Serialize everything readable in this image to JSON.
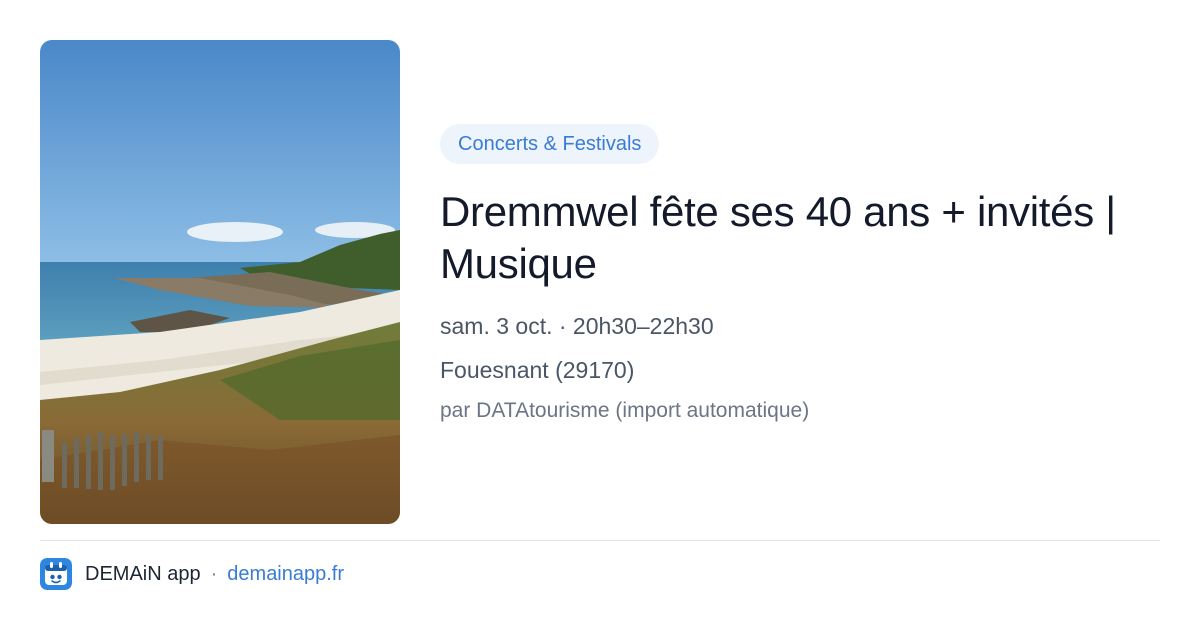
{
  "event": {
    "category": "Concerts & Festivals",
    "title": "Dremmwel fête ses 40 ans + invités | Musique",
    "date": "sam. 3 oct. · 20h30–22h30",
    "location": "Fouesnant (29170)",
    "source": "par DATAtourisme (import automatique)"
  },
  "footer": {
    "app_name": "DEMAiN app",
    "separator": "·",
    "url": "demainapp.fr"
  },
  "colors": {
    "accent": "#3a7bd5",
    "badge_bg": "#eef4fb",
    "title": "#141a2a",
    "meta": "#4a5565"
  }
}
